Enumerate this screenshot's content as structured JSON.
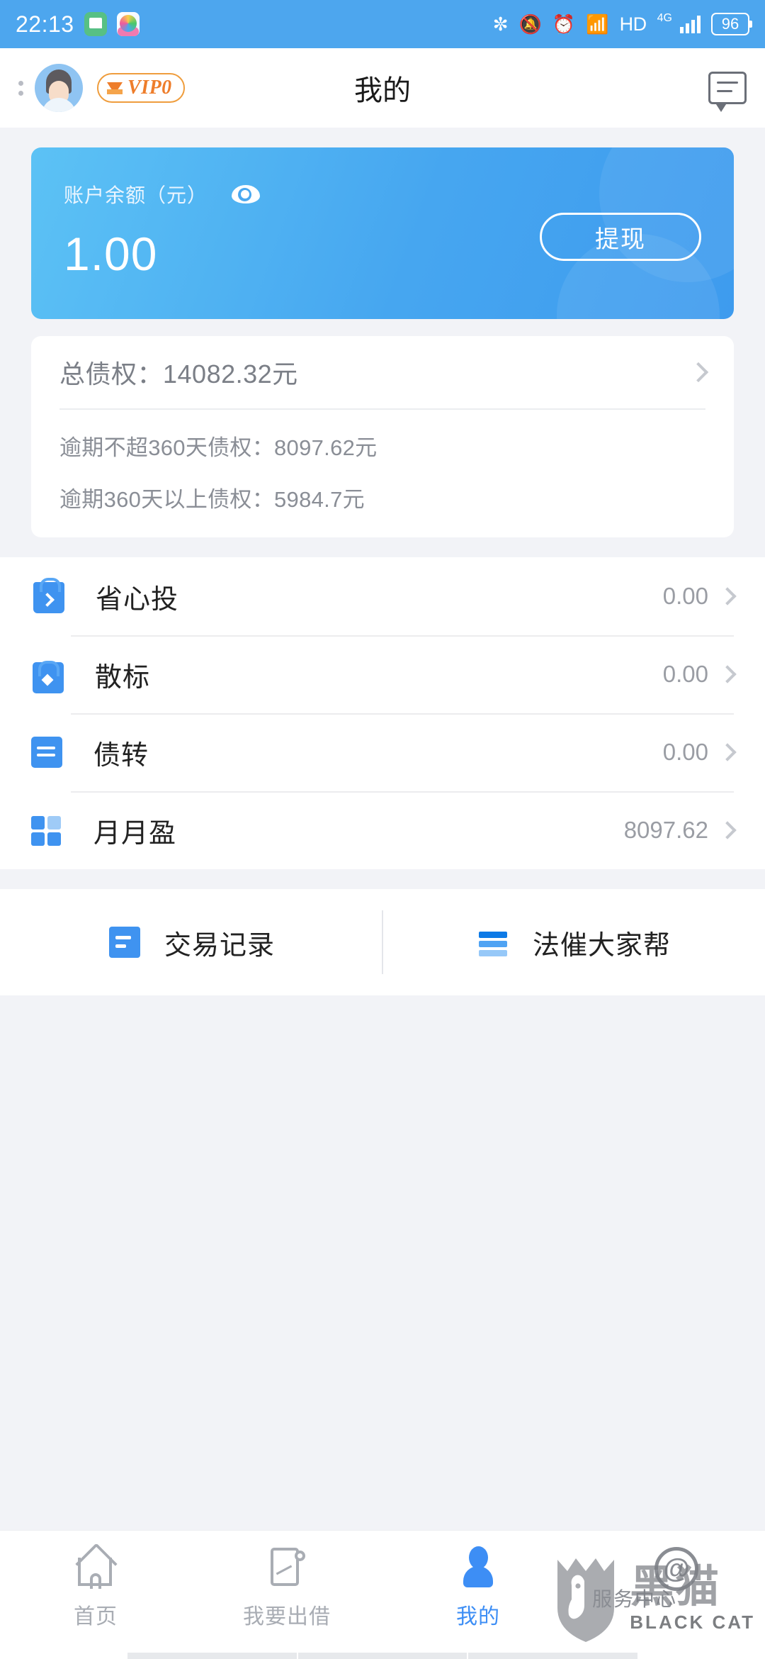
{
  "status_bar": {
    "time": "22:13",
    "icons": [
      "message-app-icon",
      "media-app-icon",
      "bluetooth-icon",
      "mute-icon",
      "alarm-icon",
      "wifi-icon"
    ],
    "hd_label": "HD",
    "network_label": "4G",
    "battery_level": "96"
  },
  "header": {
    "title": "我的",
    "vip_label": "VIP0",
    "avatar_name": "user-avatar",
    "message_icon": "message-icon",
    "menu_icon": "more-dots-icon"
  },
  "balance_card": {
    "label": "账户余额（元）",
    "amount": "1.00",
    "eye_icon": "eye-visibility-icon",
    "withdraw_label": "提现",
    "gradient_start": "#5cc2f5",
    "gradient_end": "#3e9bee"
  },
  "debt_card": {
    "total_label": "总债权：14082.32元",
    "overdue_under_360": "逾期不超360天债权：8097.62元",
    "overdue_over_360": "逾期360天以上债权：5984.7元"
  },
  "product_list": [
    {
      "icon": "bag-icon",
      "label": "省心投",
      "value": "0.00"
    },
    {
      "icon": "lock-icon",
      "label": "散标",
      "value": "0.00"
    },
    {
      "icon": "swap-icon",
      "label": "债转",
      "value": "0.00"
    },
    {
      "icon": "grid-icon",
      "label": "月月盈",
      "value": "8097.62"
    }
  ],
  "shortcuts": [
    {
      "icon": "document-icon",
      "label": "交易记录"
    },
    {
      "icon": "stripes-icon",
      "label": "法催大家帮"
    }
  ],
  "bottom_nav": [
    {
      "icon": "home-icon",
      "label": "首页",
      "active": false
    },
    {
      "icon": "lend-icon",
      "label": "我要出借",
      "active": false
    },
    {
      "icon": "person-icon",
      "label": "我的",
      "active": true
    }
  ],
  "watermark": {
    "cn": "黑猫",
    "en": "BLACK CAT",
    "sub": "服务中心",
    "at": "@"
  },
  "colors": {
    "accent": "#3d8ef5",
    "status_bar": "#4da6ee",
    "vip_orange": "#ee7d2b",
    "page_bg": "#f2f3f7"
  }
}
